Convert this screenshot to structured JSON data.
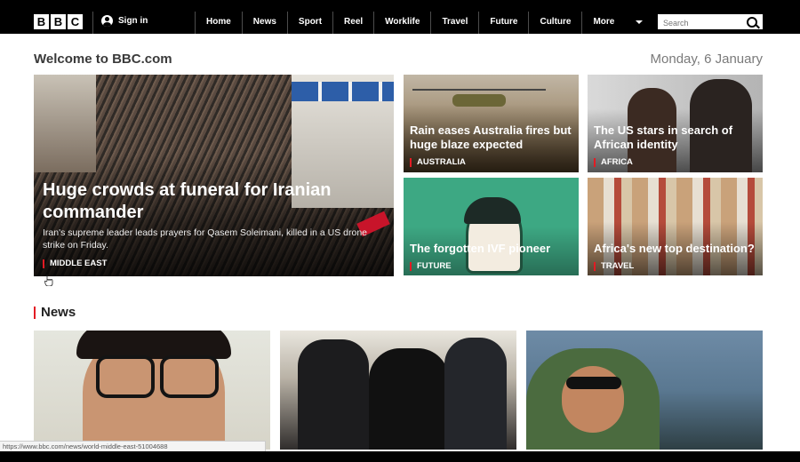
{
  "header": {
    "logo_letters": [
      "B",
      "B",
      "C"
    ],
    "signin_label": "Sign in",
    "nav": [
      "Home",
      "News",
      "Sport",
      "Reel",
      "Worklife",
      "Travel",
      "Future",
      "Culture",
      "More"
    ],
    "search_placeholder": "Search"
  },
  "welcome": {
    "title": "Welcome to BBC.com",
    "date": "Monday, 6 January"
  },
  "hero": {
    "title": "Huge crowds at funeral for Iranian commander",
    "summary": "Iran's supreme leader leads prayers for Qasem Soleimani, killed in a US drone strike on Friday.",
    "tag": "MIDDLE EAST"
  },
  "cards": [
    {
      "title": "Rain eases Australia fires but huge blaze expected",
      "tag": "AUSTRALIA"
    },
    {
      "title": "The US stars in search of African identity",
      "tag": "AFRICA"
    },
    {
      "title": "The forgotten IVF pioneer",
      "tag": "FUTURE"
    },
    {
      "title": "Africa's new top destination?",
      "tag": "TRAVEL"
    }
  ],
  "news_section": {
    "title": "News"
  },
  "status_url": "https://www.bbc.com/news/world-middle-east-51004688",
  "colors": {
    "accent": "#e31b23",
    "bar": "#000000"
  }
}
